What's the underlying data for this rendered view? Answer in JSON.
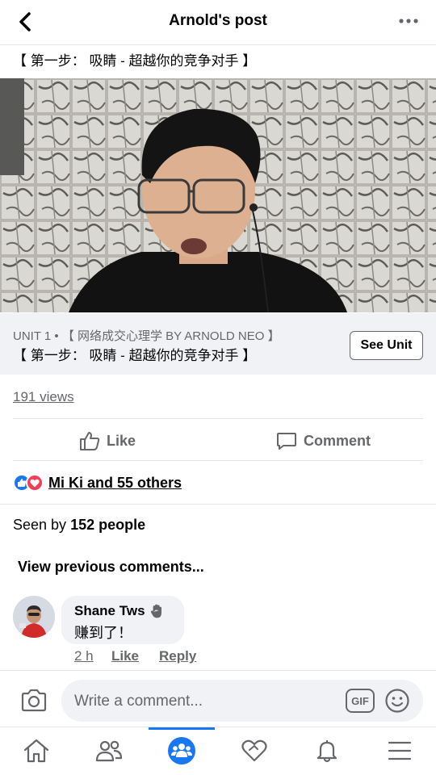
{
  "header": {
    "title": "Arnold's post",
    "back_icon": "chevron-left-icon",
    "more_icon": "more-horizontal-icon"
  },
  "post": {
    "text": "【 第一步： 吸睛 - 超越你的竞争对手 】"
  },
  "unit": {
    "label": "UNIT 1 • 【 网络成交心理学 BY ARNOLD NEO 】",
    "title": "【 第一步： 吸睛 - 超越你的竞争对手 】",
    "button_label": "See Unit"
  },
  "stats": {
    "views": "191 views"
  },
  "actions": {
    "like_label": "Like",
    "comment_label": "Comment"
  },
  "reactions": {
    "icons": [
      "like-reaction-icon",
      "love-reaction-icon"
    ],
    "text": "Mi Ki and 55 others"
  },
  "seen": {
    "prefix": "Seen by",
    "count": "152 people"
  },
  "comments": {
    "view_previous_label": "View previous comments...",
    "items": [
      {
        "author": "Shane Tws",
        "badge_icon": "wave-hand-icon",
        "text": "赚到了！",
        "time": "2 h",
        "like_label": "Like",
        "reply_label": "Reply"
      }
    ]
  },
  "composer": {
    "placeholder": "Write a comment...",
    "gif_label": "GIF",
    "camera_icon": "camera-icon",
    "emoji_icon": "smiley-icon"
  },
  "tabbar": {
    "items": [
      "home-icon",
      "friends-icon",
      "groups-icon",
      "dating-heart-icon",
      "notifications-bell-icon",
      "menu-icon"
    ],
    "active_index": 2
  },
  "colors": {
    "accent": "#1877f2",
    "secondary_text": "#65676b",
    "surface": "#f0f2f5"
  }
}
